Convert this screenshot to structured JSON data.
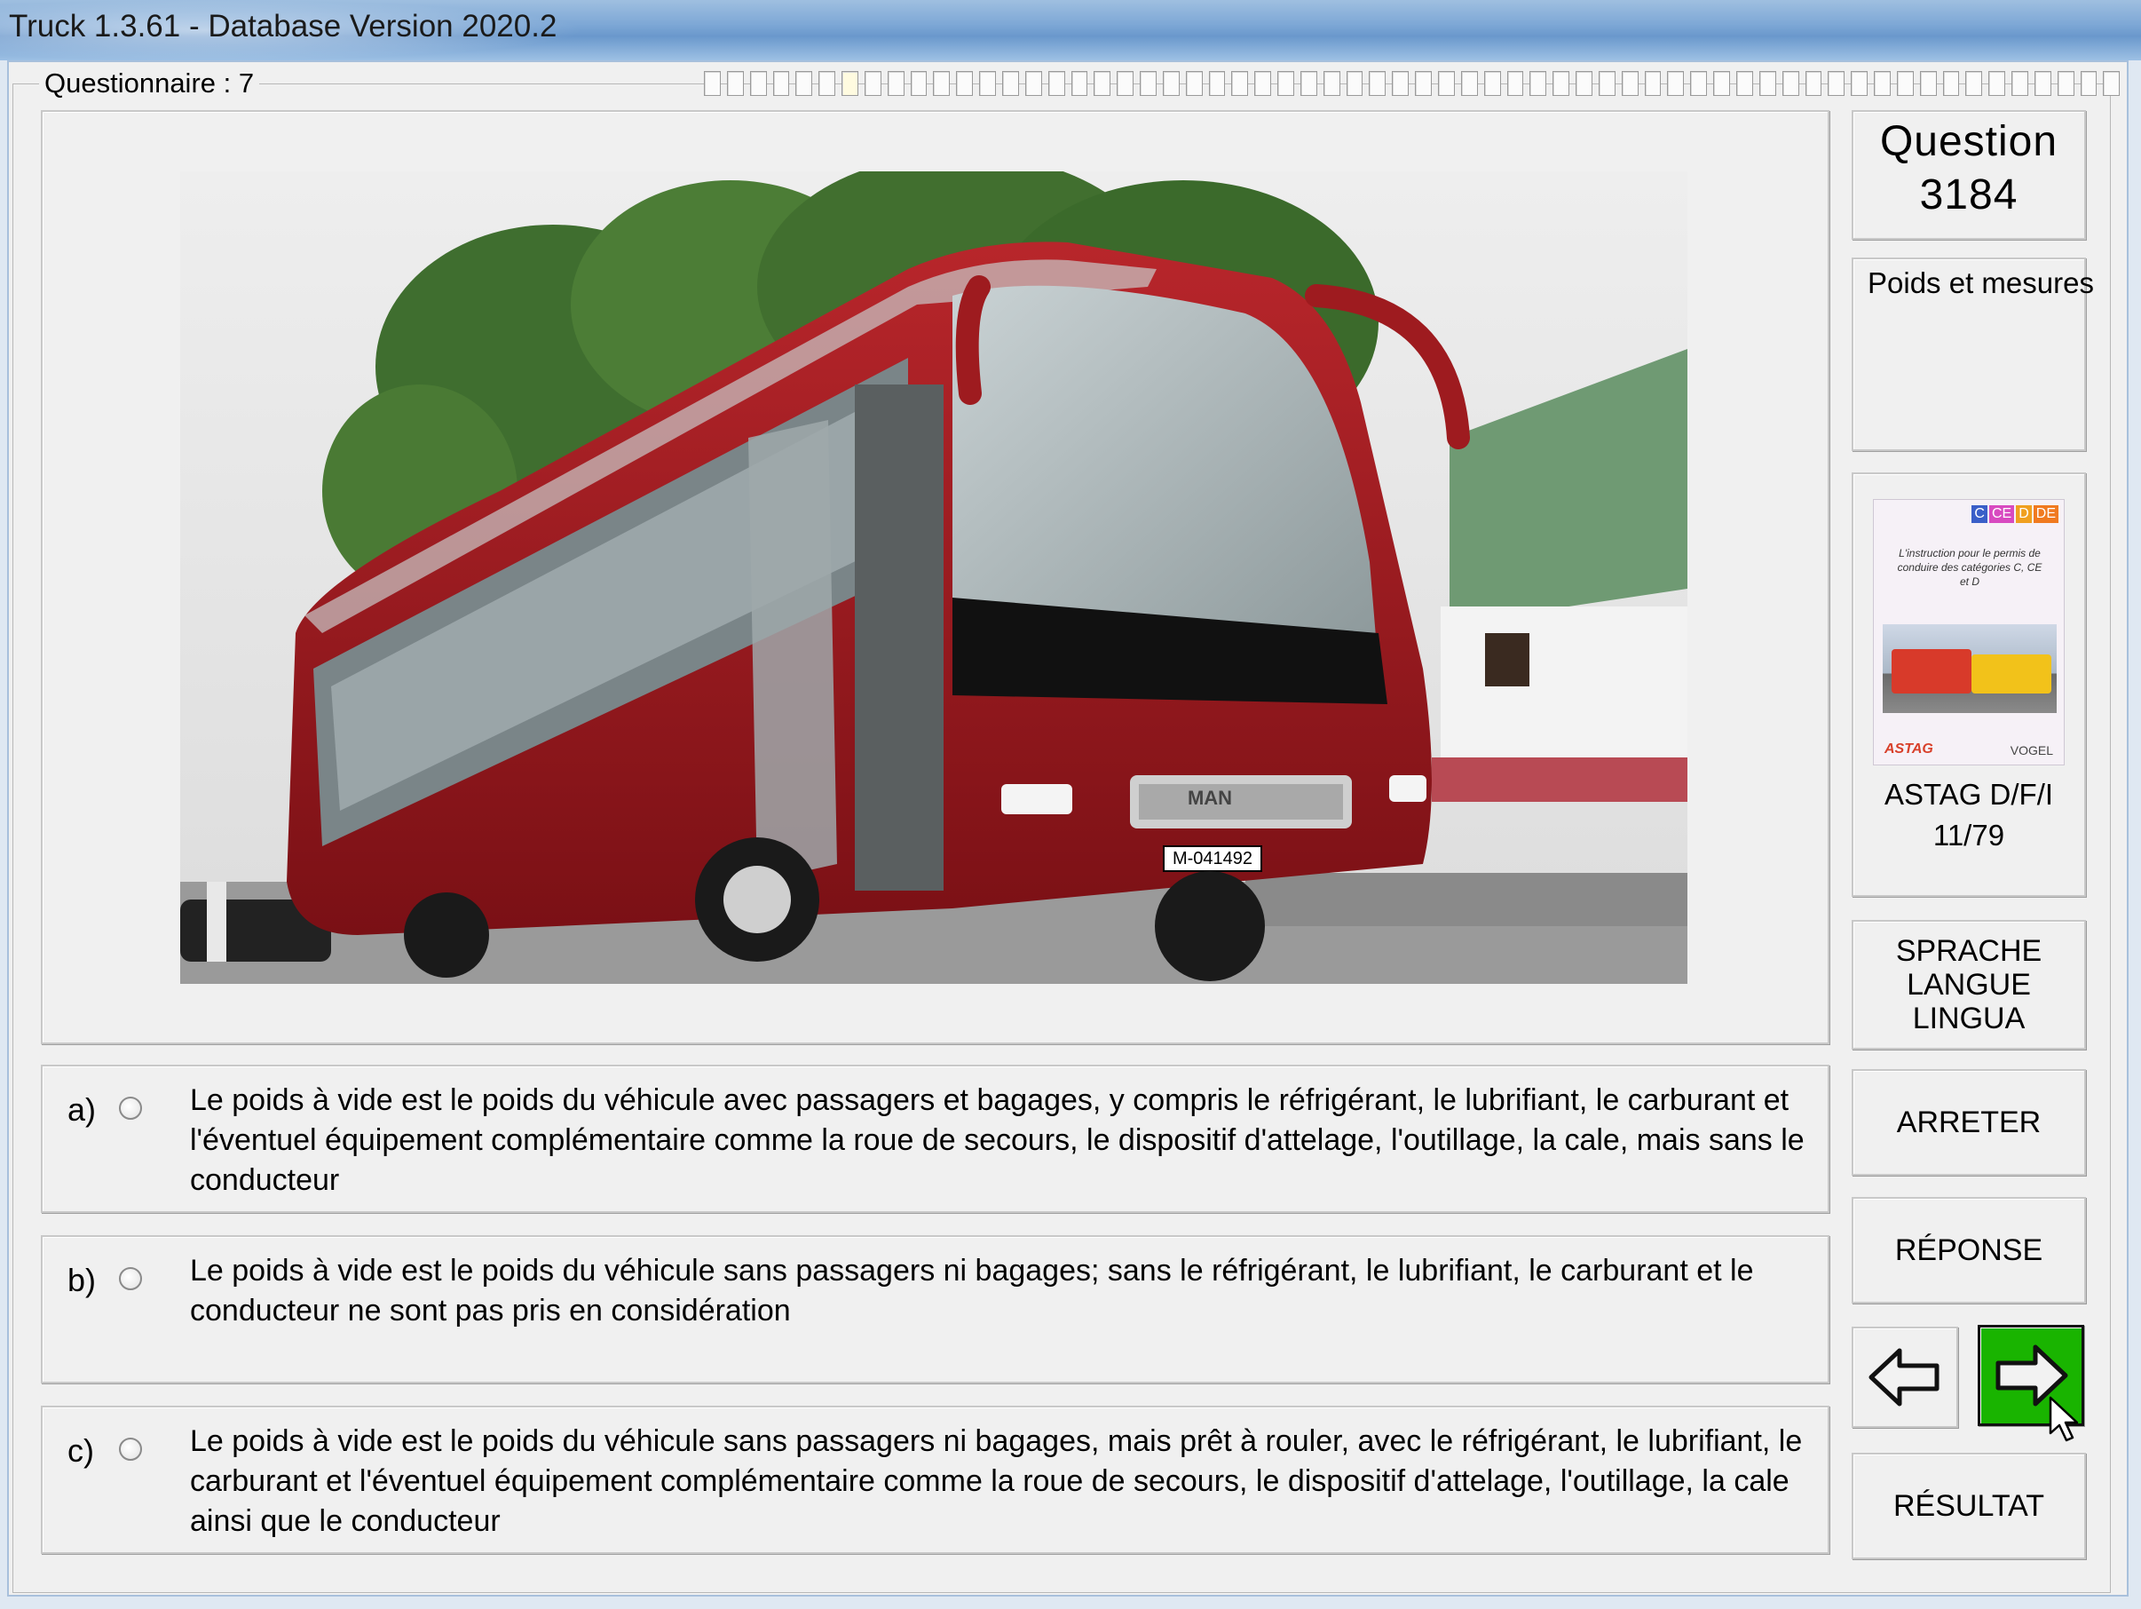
{
  "window": {
    "title": "Truck 1.3.61 - Database Version 2020.2"
  },
  "questionnaire": {
    "label": "Questionnaire : 7",
    "progress_total": 62,
    "progress_current": 7
  },
  "question": {
    "label": "Question",
    "number": "3184",
    "category": "Poids et mesures"
  },
  "reference": {
    "book_line1": "ASTAG D/F/I",
    "book_line2": "11/79",
    "cover_tags": [
      "C",
      "CE",
      "D",
      "DE"
    ],
    "cover_title": "L'instruction pour le permis de conduire des catégories C, CE et D",
    "cover_left_logo": "ASTAG",
    "cover_right_logo": "VOGEL"
  },
  "photo": {
    "plate": "M-041492",
    "brand": "MAN"
  },
  "answers": [
    {
      "letter": "a)",
      "text": "Le poids à vide est le poids du véhicule avec passagers et bagages, y compris le réfrigérant, le lubrifiant, le carburant et l'éventuel équipement complémentaire comme la roue de secours, le dispositif d'attelage, l'outillage, la cale, mais sans le conducteur"
    },
    {
      "letter": "b)",
      "text": "Le poids à vide est le poids du véhicule sans passagers ni bagages; sans le réfrigérant, le lubrifiant, le carburant et le conducteur ne sont pas pris en considération"
    },
    {
      "letter": "c)",
      "text": "Le poids à vide est le poids du véhicule sans passagers ni bagages, mais prêt à rouler, avec le réfrigérant, le lubrifiant, le carburant et l'éventuel équipement complémentaire comme la roue de secours, le dispositif d'attelage, l'outillage, la cale ainsi que le conducteur"
    }
  ],
  "buttons": {
    "language": "SPRACHE\nLANGUE\nLINGUA",
    "stop": "ARRETER",
    "answer": "RÉPONSE",
    "result": "RÉSULTAT",
    "prev_icon": "arrow-left-icon",
    "next_icon": "arrow-right-icon"
  },
  "colors": {
    "next_button": "#19b400",
    "titlebar": "#7ea8d6",
    "bus_body": "#9e1b1f"
  }
}
